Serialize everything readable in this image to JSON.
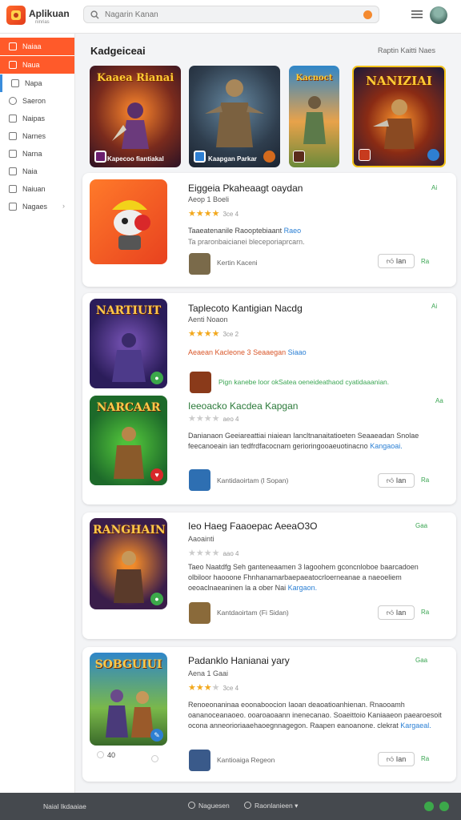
{
  "app": {
    "name": "Aplikuan",
    "subtitle": "ninrias"
  },
  "search": {
    "placeholder": "Nagarin Kanan"
  },
  "sidebar": {
    "items": [
      {
        "label": "Naiaa"
      },
      {
        "label": "Naua"
      },
      {
        "label": "Napa"
      },
      {
        "label": "Saeron"
      },
      {
        "label": "Naipas"
      },
      {
        "label": "Narnes"
      },
      {
        "label": "Narna"
      },
      {
        "label": "Naia"
      },
      {
        "label": "Naiuan"
      },
      {
        "label": "Nagaes"
      }
    ]
  },
  "section": {
    "title": "Kadgeiceai",
    "link": "Raptin Kaitti Naes"
  },
  "featured": [
    {
      "title": "Kaaea Rianai",
      "label": "Kapecoo fiantiakal"
    },
    {
      "title": "",
      "label": "Kaapgan Parkar"
    },
    {
      "title": "Kacnoct",
      "label": ""
    },
    {
      "title": "NANIZIAI",
      "label": ""
    }
  ],
  "games": [
    {
      "thumb": "",
      "title": "Eiggeia Pkaheaagt oaydan",
      "sub": "Aeop 1 Boeli",
      "rating": 4,
      "rtext": "3ce 4",
      "desc": "Taaeatenanile Raooptebiaant",
      "desc_link": "Raeo",
      "desc2": "Ta praronbaicianei bleceporiaprcarn.",
      "dev": "Kertin Kaceni",
      "btn": "Ian",
      "price": "Ra",
      "top_price": "Ai"
    },
    {
      "thumb": "NARTIUIT",
      "title": "Taplecoto Kantigian Nacdg",
      "sub": "Aenti Noaon",
      "rating": 3,
      "rtext": "3ce 2",
      "desc": "Aeaean Kacleone 3 Seaaegan",
      "desc_link": "Siaao",
      "dev": "Pign kanebe loor okSatea oeneideathaod cyatidaaanian.",
      "btn": "",
      "price": "",
      "top_price": "Ai"
    },
    {
      "thumb": "NARCAAR",
      "title": "Ieeoacko Kacdea Kapgan",
      "sub": "",
      "rating": 0,
      "rtext": "aeo 4",
      "desc": "Danianaon Geeiareattiai niaiean Iancltnanaitatioeten Seaaeadan Snolae feecanoeain ian tedfrdfacocnam gerioringooaeuotinacno",
      "desc_link": "Kangaoai.",
      "dev": "Kantidaoirtam (l Sopan)",
      "btn": "Ian",
      "price": "Ra",
      "top_price": "Aa"
    },
    {
      "thumb": "RANGHAIN",
      "title": "Ieo Haeg Faaoepac AeeaO3O",
      "sub": "Aaoainti",
      "rating": 0,
      "rtext": "aao 4",
      "desc": "Taeo Naatdfg Seh ganteneaamen 3 lagoohem gconcnloboe baarcadoen olbiloor haooone Fhnhanamarbaepaeatocrloerneanae a naeoeliem oeoaclnaeaninen la a ober Nai",
      "desc_link": "Kargaon.",
      "dev": "Kantdaoirtam (Fi Sidan)",
      "btn": "Ian",
      "price": "Ra",
      "top_price": "Gaa"
    },
    {
      "thumb": "SOBGUIUI",
      "title": "Padanklo Hanianai yary",
      "sub": "Aena 1 Gaai",
      "rating": 3,
      "rtext": "3ce 4",
      "desc": "Renoeonaninaa eoonaboocion Iaoan deaoatioanhienan. Rnaooamh oananoceanaoeo. ooaroaoaann inenecanao. Soaeittoio Kaniaaeon paearoesoit ocona anneorioriaaehaoegnnagegon. Raapen eanoanone. clekrat",
      "desc_link": "Kargaeal.",
      "dev": "Kantioaiga Regeon",
      "btn": "Ian",
      "price": "Ra",
      "top_price": "Gaa",
      "stat": "40"
    }
  ],
  "bottom": {
    "left": "Naial Ikdaaiae",
    "mid": "Naguesen",
    "right": "Raonlanieen"
  }
}
